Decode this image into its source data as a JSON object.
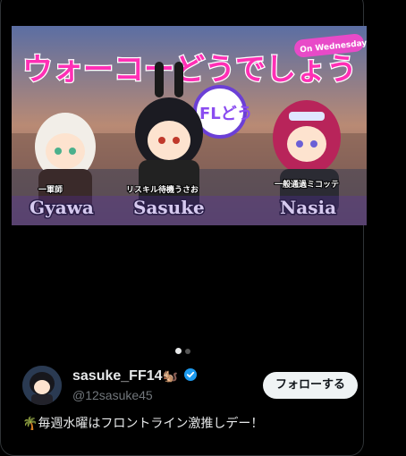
{
  "banner": {
    "title_jp": "ウォーコーどうでしょう",
    "badge": "On Wednesdays!",
    "logo": "FLどう",
    "characters": [
      {
        "role": "一軍師",
        "name": "Gyawa"
      },
      {
        "role": "リスキル待機うさお",
        "name": "Sasuke"
      },
      {
        "role": "一般通過ミコッテ",
        "name": "Nasia"
      }
    ]
  },
  "carousel": {
    "count": 2,
    "active": 0
  },
  "user": {
    "display_name": "sasuke_FF14",
    "name_emoji": "🐿️",
    "handle": "@12sasuke45",
    "follow_label": "フォローする"
  },
  "post": {
    "text": "🌴毎週水曜はフロントライン激推しデー！"
  },
  "colors": {
    "follow_bg": "#eff3f4",
    "verified": "#1d9bf0",
    "title_pink": "#ff2fb5"
  }
}
